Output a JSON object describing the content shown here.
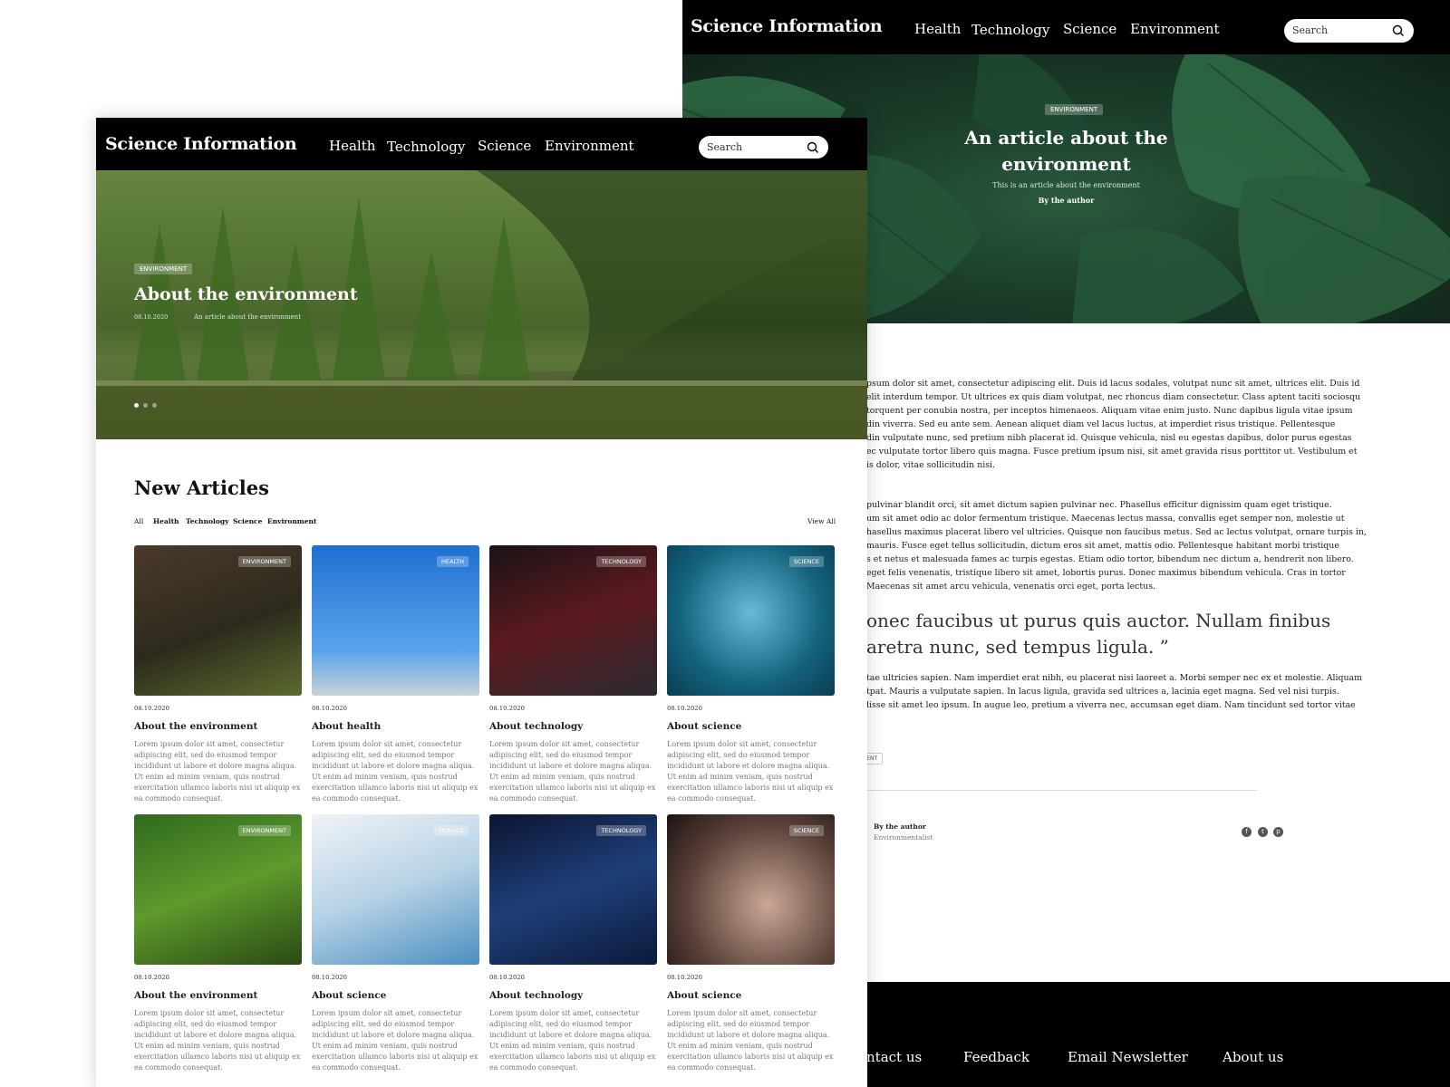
{
  "site": {
    "logo": "Science Information",
    "search_placeholder": "Search"
  },
  "nav": [
    "Health",
    "Technology",
    "Science",
    "Environment"
  ],
  "article_page": {
    "hero": {
      "category": "ENVIRONMENT",
      "title_line1": "An article about the",
      "title_line2": "environment",
      "subtitle": "This is an article about the environment",
      "byline": "By the author"
    },
    "paragraph1": [
      "psum dolor sit amet, consectetur adipiscing elit. Duis id lacus sodales, volutpat nunc sit amet, ultrices elit. Duis id",
      "elit interdum tempor. Ut ultrices ex quis diam volutpat, nec rhoncus diam consectetur. Class aptent taciti sociosqu",
      "torquent per conubia nostra, per inceptos himenaeos. Aliquam vitae enim justo. Nunc dapibus ligula vitae ipsum",
      "din viverra. Sed eu ante sem. Aenean aliquet diam vel lacus luctus, at imperdiet risus tristique. Pellentesque",
      "din vulputate nunc, sed pretium nibh placerat id. Quisque vehicula, nisl eu egestas dapibus, dolor purus egestas",
      "ec vulputate tortor libero quis magna. Fusce pretium ipsum nisi, sit amet gravida risus porttitor ut. Vestibulum et",
      "is dolor, vitae sollicitudin nisi."
    ],
    "paragraph2": [
      "pulvinar blandit orci, sit amet dictum sapien pulvinar nec. Phasellus efficitur dignissim quam eget tristique.",
      "um sit amet odio ac dolor fermentum tristique. Maecenas lectus massa, convallis eget semper non, molestie ut",
      "hasellus maximus placerat libero vel ultricies. Quisque non faucibus metus. Sed ac lectus volutpat, ornare turpis in,",
      "mauris. Fusce eget tellus sollicitudin, dictum eros sit amet, mattis odio. Pellentesque habitant morbi tristique",
      "s et netus et malesuada fames ac turpis egestas. Etiam odio tortor, bibendum nec dictum a, hendrerit non libero.",
      "eget felis venenatis, tristique libero sit amet, lobortis purus. Donec maximus bibendum vehicula. Cras in tortor",
      "Maecenas sit amet arcu vehicula, venenatis orci eget, porta lectus."
    ],
    "quote_line1": "onec faucibus ut purus quis auctor. Nullam finibus",
    "quote_line2": "aretra nunc, sed tempus ligula. ”",
    "paragraph3": [
      "tae ultricies sapien. Nam imperdiet erat nibh, eu placerat nisi laoreet a. Morbi semper nec ex et molestie. Aliquam",
      "tpat. Mauris a vulputate sapien. In lacus ligula, gravida sed ultrices a, lacinia eget magna. Sed vel nisi turpis.",
      "lisse sit amet leo ipsum. In augue leo, pretium a viverra nec, accumsan eget diam. Nam tincidunt sed tortor vitae"
    ],
    "tag": "MENT",
    "author_name": "By the author",
    "author_role": "Environmentalist",
    "social": [
      "f",
      "t",
      "p"
    ],
    "footer_links": [
      "ntact us",
      "Feedback",
      "Email Newsletter",
      "About us"
    ]
  },
  "home_page": {
    "hero": {
      "category": "ENVIRONMENT",
      "title": "About the environment",
      "date": "08.10.2020",
      "subtitle": "An article about the environment"
    },
    "section_title": "New Articles",
    "filters": [
      "All",
      "Health",
      "Technology",
      "Science",
      "Environment"
    ],
    "view_all": "View All",
    "cards": [
      {
        "category": "ENVIRONMENT",
        "date": "08.10.2020",
        "title": "About the environment",
        "desc": "Lorem ipsum dolor sit amet, consectetur adipiscing elit, sed do eiusmod tempor incididunt ut labore et dolore magna aliqua. Ut enim ad minim veniam, quis nostrud exercitation ullamco laboris nisi ut aliquip ex ea commodo consequat."
      },
      {
        "category": "HEALTH",
        "date": "08.10.2020",
        "title": "About health",
        "desc": "Lorem ipsum dolor sit amet, consectetur adipiscing elit, sed do eiusmod tempor incididunt ut labore et dolore magna aliqua. Ut enim ad minim veniam, quis nostrud exercitation ullamco laboris nisi ut aliquip ex ea commodo consequat."
      },
      {
        "category": "TECHNOLOGY",
        "date": "08.10.2020",
        "title": "About technology",
        "desc": "Lorem ipsum dolor sit amet, consectetur adipiscing elit, sed do eiusmod tempor incididunt ut labore et dolore magna aliqua. Ut enim ad minim veniam, quis nostrud exercitation ullamco laboris nisi ut aliquip ex ea commodo consequat."
      },
      {
        "category": "SCIENCE",
        "date": "08.10.2020",
        "title": "About science",
        "desc": "Lorem ipsum dolor sit amet, consectetur adipiscing elit, sed do eiusmod tempor incididunt ut labore et dolore magna aliqua. Ut enim ad minim veniam, quis nostrud exercitation ullamco laboris nisi ut aliquip ex ea commodo consequat."
      },
      {
        "category": "ENVIRONMENT",
        "date": "08.10.2020",
        "title": "About the environment",
        "desc": "Lorem ipsum dolor sit amet, consectetur adipiscing elit, sed do eiusmod tempor incididunt ut labore et dolore magna aliqua. Ut enim ad minim veniam, quis nostrud exercitation ullamco laboris nisi ut aliquip ex ea commodo consequat."
      },
      {
        "category": "SCIENCE",
        "date": "08.10.2020",
        "title": "About science",
        "desc": "Lorem ipsum dolor sit amet, consectetur adipiscing elit, sed do eiusmod tempor incididunt ut labore et dolore magna aliqua. Ut enim ad minim veniam, quis nostrud exercitation ullamco laboris nisi ut aliquip ex ea commodo consequat."
      },
      {
        "category": "TECHNOLOGY",
        "date": "08.10.2020",
        "title": "About technology",
        "desc": "Lorem ipsum dolor sit amet, consectetur adipiscing elit, sed do eiusmod tempor incididunt ut labore et dolore magna aliqua. Ut enim ad minim veniam, quis nostrud exercitation ullamco laboris nisi ut aliquip ex ea commodo consequat."
      },
      {
        "category": "SCIENCE",
        "date": "08.10.2020",
        "title": "About science",
        "desc": "Lorem ipsum dolor sit amet, consectetur adipiscing elit, sed do eiusmod tempor incididunt ut labore et dolore magna aliqua. Ut enim ad minim veniam, quis nostrud exercitation ullamco laboris nisi ut aliquip ex ea commodo consequat."
      }
    ]
  }
}
